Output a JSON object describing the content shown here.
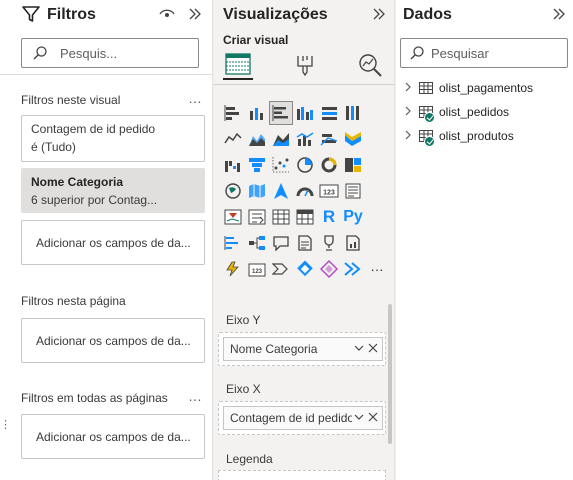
{
  "filters": {
    "title": "Filtros",
    "search_placeholder": "Pesquis...",
    "section_visual": "Filtros neste visual",
    "section_page": "Filtros nesta página",
    "section_all": "Filtros em todas as páginas",
    "cards": [
      {
        "line1": "Contagem de id pedido",
        "line2": "é (Tudo)"
      },
      {
        "line1": "Nome Categoria",
        "line2": "6 superior por Contag..."
      }
    ],
    "add_visual": "Adicionar os campos de da...",
    "add_page": "Adicionar os campos de da...",
    "add_all": "Adicionar os campos de da...",
    "more_dots": "…",
    "side_dots": "⋮"
  },
  "viz": {
    "title": "Visualizações",
    "criar_label": "Criar visual",
    "more_label": "···",
    "r_label": "R",
    "py_label": "Py",
    "kpi_label": "123",
    "wells": {
      "eixo_y_label": "Eixo Y",
      "eixo_y_value": "Nome Categoria",
      "eixo_x_label": "Eixo X",
      "eixo_x_value": "Contagem de id pedido",
      "legenda_label": "Legenda"
    }
  },
  "data_pane": {
    "title": "Dados",
    "search_placeholder": "Pesquisar",
    "tables": [
      {
        "name": "olist_pagamentos",
        "status": "none"
      },
      {
        "name": "olist_pedidos",
        "status": "in-use"
      },
      {
        "name": "olist_produtos",
        "status": "in-use"
      }
    ]
  },
  "colors": {
    "accent_teal": "#117865",
    "accent_blue": "#118dff",
    "accent_yellow": "#e8b500",
    "accent_red": "#c23b22"
  }
}
